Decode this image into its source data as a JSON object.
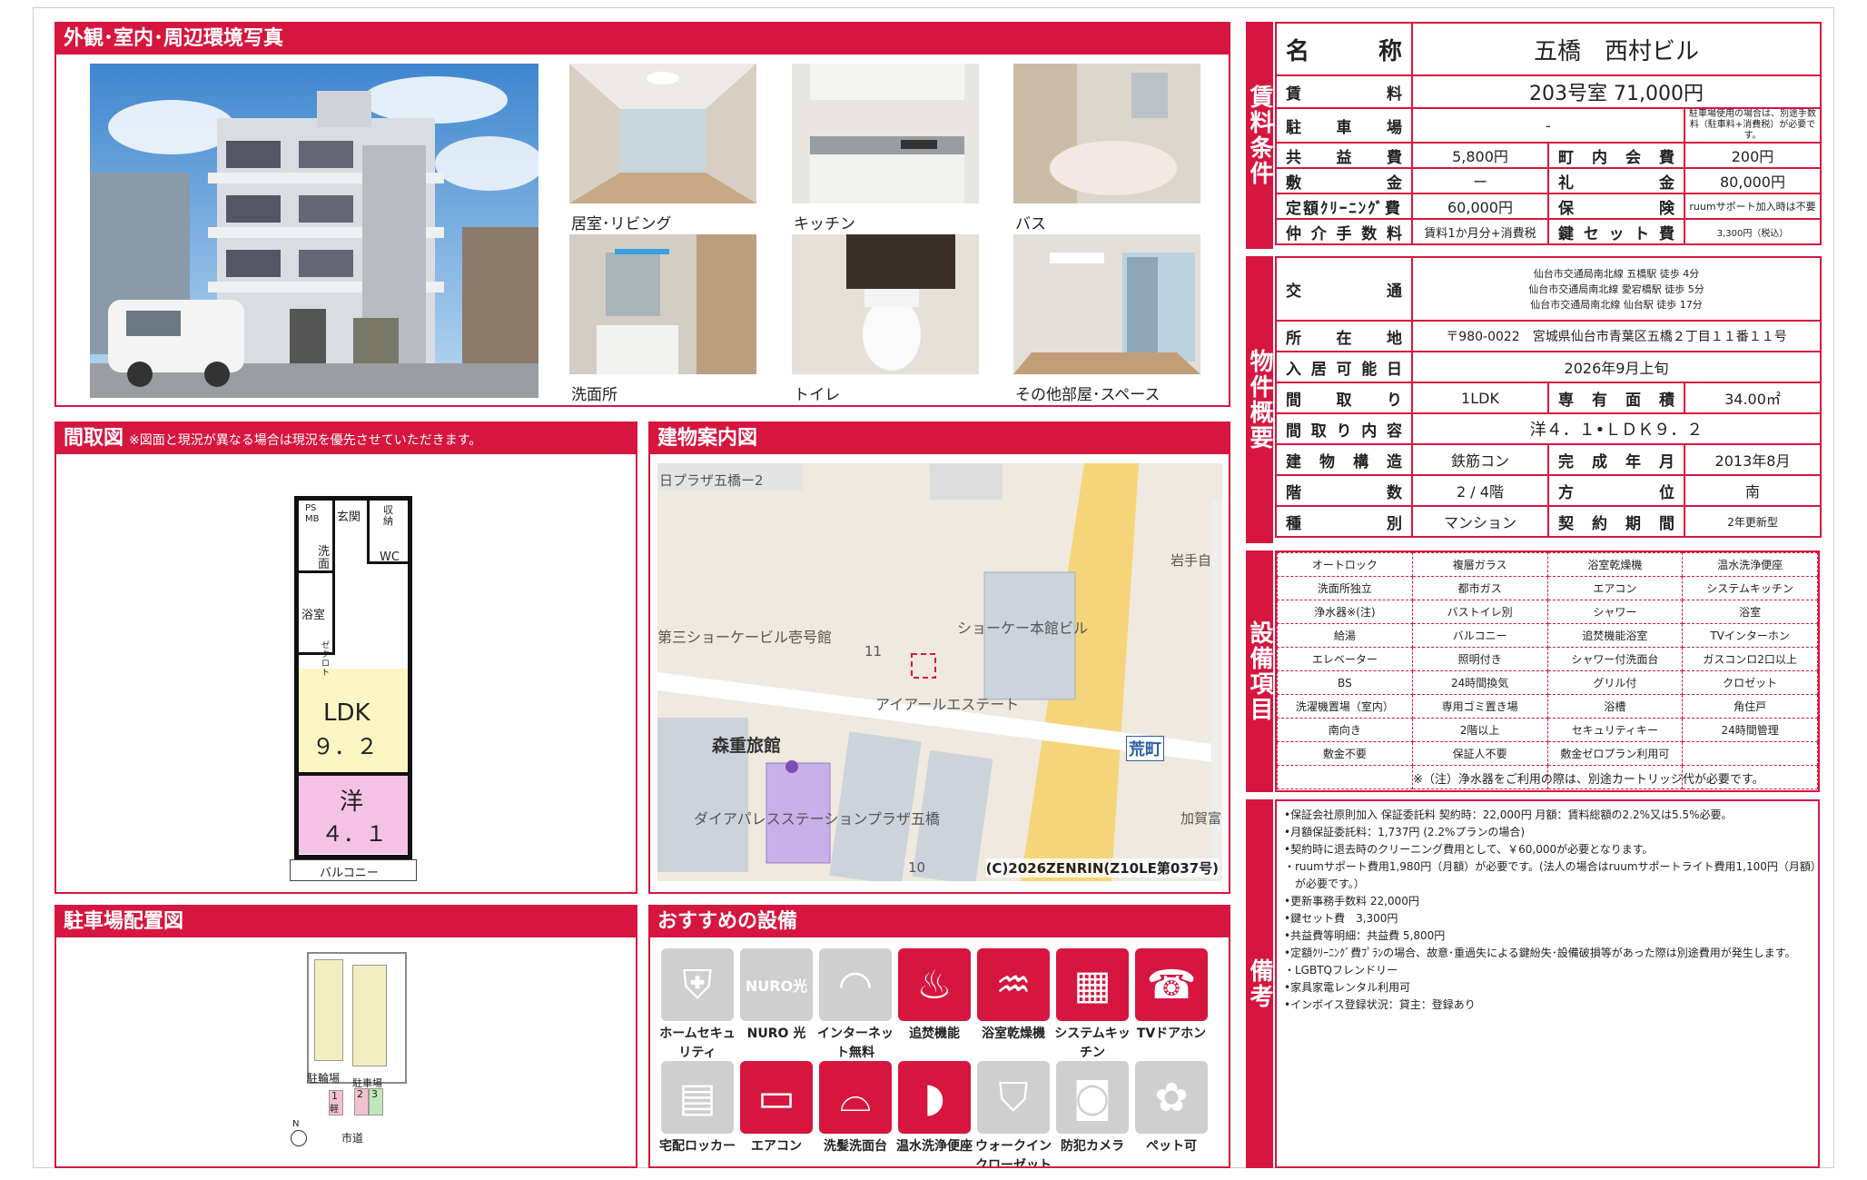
{
  "photos": {
    "title": "外観･室内･周辺環境写真",
    "captions": [
      "居室･リビング",
      "キッチン",
      "バス",
      "洗面所",
      "トイレ",
      "その他部屋･スペース"
    ]
  },
  "floorplan": {
    "title": "間取図",
    "note": "※図面と現況が異なる場合は現況を優先させていただきます。",
    "labels": {
      "ps": "PS",
      "mb": "MB",
      "entrance": "玄関",
      "storage": "収納",
      "wash": "洗面",
      "wc": "WC",
      "bath": "浴室",
      "closet": "ゼクロト",
      "ldk": "LDK",
      "ldk_size": "９．２",
      "western": "洋",
      "western_size": "４．１",
      "balcony": "バルコニー"
    }
  },
  "map": {
    "title": "建物案内図",
    "labels": [
      "日プラザ五橋ー2",
      "岩手自",
      "ショーケー本館ビル",
      "第三ショーケービル壱号館",
      "11",
      "アイアールエステート",
      "森重旅館",
      "荒町",
      "ダイアパレスステーションプラザ五橋",
      "加賀富",
      "10"
    ],
    "copyright": "(C)2026ZENRIN(Z10LE第037号)"
  },
  "parking": {
    "title": "駐車場配置図",
    "labels": {
      "bike": "駐輪場",
      "car": "駐車場",
      "s1": "1",
      "s1b": "軽",
      "s2": "2",
      "s3": "3",
      "road": "市道",
      "north": "N"
    }
  },
  "recommended": {
    "title": "おすすめの設備",
    "items": [
      {
        "label": "ホームセキュリティ",
        "active": false,
        "icon": "shield-icon"
      },
      {
        "label": "NURO 光",
        "active": false,
        "icon": "nuro-icon",
        "icon_text": "NURO光"
      },
      {
        "label": "インターネット無料",
        "active": false,
        "icon": "wifi-icon"
      },
      {
        "label": "追焚機能",
        "active": true,
        "icon": "bathtub-icon"
      },
      {
        "label": "浴室乾燥機",
        "active": true,
        "icon": "bath-dryer-icon"
      },
      {
        "label": "システムキッチン",
        "active": true,
        "icon": "kitchen-icon"
      },
      {
        "label": "TVドアホン",
        "active": true,
        "icon": "intercom-icon"
      },
      {
        "label": "宅配ロッカー",
        "active": false,
        "icon": "locker-icon"
      },
      {
        "label": "エアコン",
        "active": true,
        "icon": "aircon-icon"
      },
      {
        "label": "洗髪洗面台",
        "active": true,
        "icon": "washbasin-icon"
      },
      {
        "label": "温水洗浄便座",
        "active": true,
        "icon": "toilet-icon"
      },
      {
        "label": "ウォークインクローゼット",
        "active": false,
        "icon": "closet-icon"
      },
      {
        "label": "防犯カメラ",
        "active": false,
        "icon": "camera-icon"
      },
      {
        "label": "ペット可",
        "active": false,
        "icon": "paw-icon"
      }
    ]
  },
  "terms": {
    "side": "賃料条件",
    "name_label": "名称",
    "name": "五橋　西村ビル",
    "rent_label": "賃料",
    "rent": "203号室 71,000円",
    "parking_label": "駐車場",
    "parking": "-",
    "parking_note": "駐車場使用の場合は、別途手数料（駐車料+消費税）が必要です。",
    "common_label": "共益費",
    "common": "5,800円",
    "town_label": "町内会費",
    "town": "200円",
    "deposit_label": "敷金",
    "deposit": "ー",
    "key_money_label": "礼金",
    "key_money": "80,000円",
    "cleaning_label": "定額ｸﾘｰﾆﾝｸﾞ費",
    "cleaning": "60,000円",
    "insurance_label": "保険",
    "insurance": "ruumサポート加入時は不要",
    "broker_label": "仲介手数料",
    "broker": "賃料1か月分+消費税",
    "keyset_label": "鍵セット費",
    "keyset": "3,300円（税込）"
  },
  "property": {
    "side": "物件概要",
    "transport_label": "交通",
    "transport": [
      "仙台市交通局南北線 五橋駅 徒歩 4分",
      "仙台市交通局南北線 愛宕橋駅 徒歩 5分",
      "仙台市交通局南北線 仙台駅 徒歩 17分"
    ],
    "address_label": "所在地",
    "address": "〒980-0022　宮城県仙台市青葉区五橋２丁目１１番１１号",
    "available_label": "入居可能日",
    "available": "2026年9月上旬",
    "layout_label": "間取り",
    "layout": "1LDK",
    "area_label": "専有面積",
    "area": "34.00㎡",
    "detail_label": "間取り内容",
    "detail": "洋４．１•ＬＤＫ９．２",
    "structure_label": "建物構造",
    "structure": "鉄筋コン",
    "built_label": "完成年月",
    "built": "2013年8月",
    "floor_label": "階数",
    "floor": "2 / 4階",
    "direction_label": "方位",
    "direction": "南",
    "type_label": "種別",
    "type": "マンション",
    "contract_label": "契約期間",
    "contract": "2年更新型"
  },
  "equipment": {
    "side": "設備項目",
    "rows": [
      [
        "オートロック",
        "複層ガラス",
        "浴室乾燥機",
        "温水洗浄便座"
      ],
      [
        "洗面所独立",
        "都市ガス",
        "エアコン",
        "システムキッチン"
      ],
      [
        "浄水器※(注)",
        "バストイレ別",
        "シャワー",
        "浴室"
      ],
      [
        "給湯",
        "バルコニー",
        "追焚機能浴室",
        "TVインターホン"
      ],
      [
        "エレベーター",
        "照明付き",
        "シャワー付洗面台",
        "ガスコンロ2口以上"
      ],
      [
        "BS",
        "24時間換気",
        "グリル付",
        "クロゼット"
      ],
      [
        "洗濯機置場（室内）",
        "専用ゴミ置き場",
        "浴槽",
        "角住戸"
      ],
      [
        "南向き",
        "2階以上",
        "セキュリティキー",
        "24時間管理"
      ],
      [
        "敷金不要",
        "保証人不要",
        "敷金ゼロプラン利用可",
        ""
      ],
      [
        "",
        "",
        "",
        ""
      ]
    ],
    "note": "※（注）浄水器をご利用の際は、別途カートリッジ代が必要です。"
  },
  "remarks": {
    "side": "備考",
    "lines": [
      "•保証会社原則加入 保証委託料 契約時：22,000円 月額：賃料総額の2.2%又は5.5%必要。",
      "•月額保証委託料：1,737円 (2.2%プランの場合)",
      "•契約時に退去時のクリーニング費用として、￥60,000が必要となります。",
      "・ruumサポート費用1,980円（月額）が必要です。(法人の場合はruumサポートライト費用1,100円（月額）",
      "　が必要です。）",
      "•更新事務手数料 22,000円",
      "•鍵セット費　3,300円",
      "•共益費等明細：共益費 5,800円",
      "•定額ｸﾘｰﾆﾝｸﾞ費ﾌﾟﾗﾝの場合、故意･重過失による鍵紛失･設備破損等があった際は別途費用が発生します。",
      "・LGBTQフレンドリー",
      "•家具家電レンタル利用可",
      "•インボイス登録状況：貸主：登録あり"
    ]
  }
}
